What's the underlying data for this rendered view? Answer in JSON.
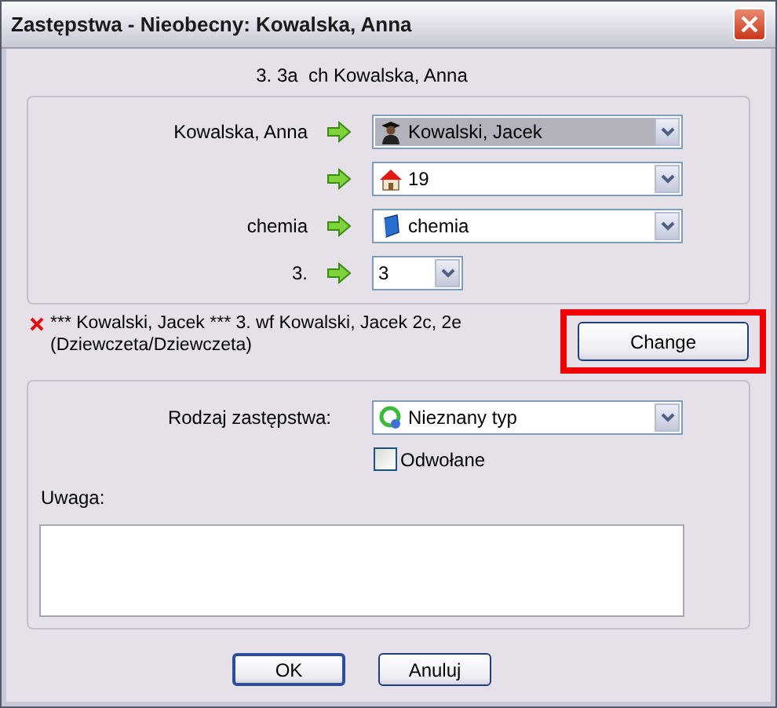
{
  "window": {
    "title": "Zastępstwa - Nieobecny: Kowalska, Anna"
  },
  "lesson_info": "3. 3a  ch Kowalska, Anna",
  "assignment_rows": [
    {
      "label": "Kowalska, Anna",
      "kind": "teacher",
      "value": "Kowalski, Jacek",
      "highlighted": true
    },
    {
      "kind": "room",
      "value": "19",
      "highlighted": false
    },
    {
      "label": "chemia",
      "kind": "subject",
      "value": "chemia",
      "highlighted": false
    },
    {
      "label": "3.",
      "kind": "number",
      "value": "3",
      "highlighted": false
    }
  ],
  "conflict": {
    "lines": [
      "*** Kowalski, Jacek *** 3. wf Kowalski, Jacek 2c, 2e",
      "(Dziewczeta/Dziewczeta)"
    ],
    "button": "Change"
  },
  "substitution_type": {
    "label": "Rodzaj zastępstwa:",
    "value": "Nieznany typ"
  },
  "cancelled": {
    "label": "Odwołane",
    "checked": false
  },
  "note": {
    "label": "Uwaga:"
  },
  "buttons": [
    {
      "label": "OK",
      "default": true
    },
    {
      "label": "Anuluj",
      "default": false
    }
  ]
}
